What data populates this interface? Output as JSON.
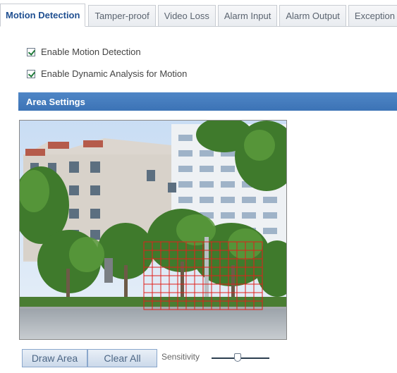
{
  "tabs": [
    {
      "label": "Motion Detection",
      "active": true
    },
    {
      "label": "Tamper-proof",
      "active": false
    },
    {
      "label": "Video Loss",
      "active": false
    },
    {
      "label": "Alarm Input",
      "active": false
    },
    {
      "label": "Alarm Output",
      "active": false
    },
    {
      "label": "Exception",
      "active": false
    }
  ],
  "options": {
    "enable_motion_detection": {
      "label": "Enable Motion Detection",
      "checked": true
    },
    "enable_dynamic_analysis": {
      "label": "Enable Dynamic Analysis for Motion",
      "checked": true
    }
  },
  "area_settings": {
    "title": "Area Settings"
  },
  "controls": {
    "draw_area_label": "Draw Area",
    "clear_all_label": "Clear All",
    "sensitivity_label": "Sensitivity",
    "sensitivity_value": 0.45
  },
  "colors": {
    "header_blue": "#3c73b6",
    "grid_red": "#e0201b",
    "active_tab_text": "#1f4f91"
  }
}
